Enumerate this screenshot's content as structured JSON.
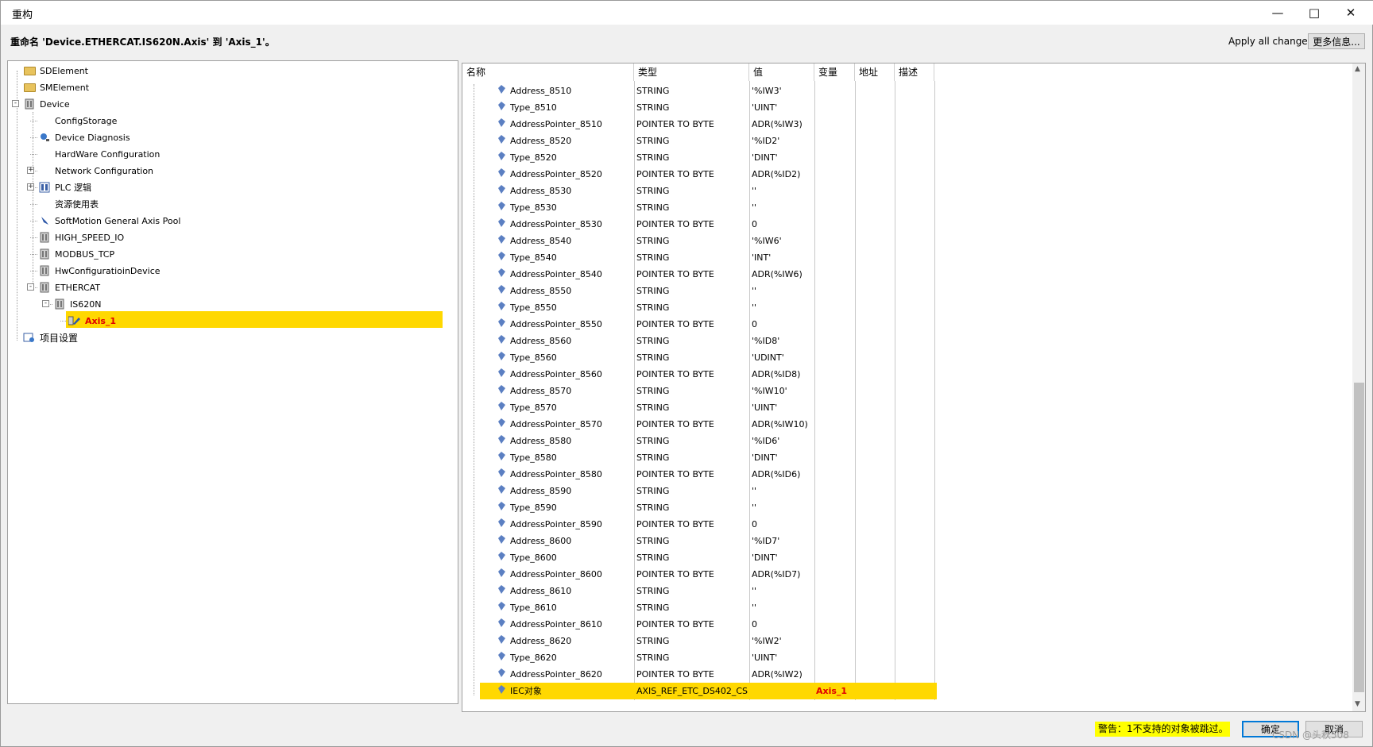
{
  "window": {
    "title": "重构",
    "minimize_icon": "minimize-icon",
    "maximize_icon": "maximize-icon",
    "close_icon": "close-icon"
  },
  "header": {
    "rename_text": "重命名 'Device.ETHERCAT.IS620N.Axis' 到 'Axis_1'。",
    "apply_label": "Apply all changes.",
    "more_button": "更多信息..."
  },
  "tree": {
    "items": [
      {
        "label": "SDElement",
        "icon": "folder-icon"
      },
      {
        "label": "SMElement",
        "icon": "folder-icon"
      },
      {
        "label": "Device",
        "icon": "device-icon"
      },
      {
        "label": "ConfigStorage",
        "icon": ""
      },
      {
        "label": "Device Diagnosis",
        "icon": "diagnosis-icon"
      },
      {
        "label": "HardWare Configuration",
        "icon": ""
      },
      {
        "label": "Network Configuration",
        "icon": ""
      },
      {
        "label": "PLC 逻辑",
        "icon": "plc-icon"
      },
      {
        "label": "资源使用表",
        "icon": ""
      },
      {
        "label": "SoftMotion General Axis Pool",
        "icon": "axis-pool-icon"
      },
      {
        "label": "HIGH_SPEED_IO",
        "icon": "module-icon"
      },
      {
        "label": "MODBUS_TCP",
        "icon": "module-icon"
      },
      {
        "label": "HwConfiguratioinDevice",
        "icon": "module-icon"
      },
      {
        "label": "ETHERCAT",
        "icon": "module-icon"
      },
      {
        "label": "IS620N",
        "icon": "module-icon"
      },
      {
        "label": "Axis_1",
        "icon": "axis-icon"
      },
      {
        "label": "项目设置",
        "icon": "project-settings-icon"
      }
    ]
  },
  "grid": {
    "columns": [
      "名称",
      "类型",
      "值",
      "变量",
      "地址",
      "描述"
    ],
    "rows": [
      {
        "name": "Address_8510",
        "type": "STRING",
        "value": "'%IW3'"
      },
      {
        "name": "Type_8510",
        "type": "STRING",
        "value": "'UINT'"
      },
      {
        "name": "AddressPointer_8510",
        "type": "POINTER TO BYTE",
        "value": "ADR(%IW3)"
      },
      {
        "name": "Address_8520",
        "type": "STRING",
        "value": "'%ID2'"
      },
      {
        "name": "Type_8520",
        "type": "STRING",
        "value": "'DINT'"
      },
      {
        "name": "AddressPointer_8520",
        "type": "POINTER TO BYTE",
        "value": "ADR(%ID2)"
      },
      {
        "name": "Address_8530",
        "type": "STRING",
        "value": "''"
      },
      {
        "name": "Type_8530",
        "type": "STRING",
        "value": "''"
      },
      {
        "name": "AddressPointer_8530",
        "type": "POINTER TO BYTE",
        "value": "0"
      },
      {
        "name": "Address_8540",
        "type": "STRING",
        "value": "'%IW6'"
      },
      {
        "name": "Type_8540",
        "type": "STRING",
        "value": "'INT'"
      },
      {
        "name": "AddressPointer_8540",
        "type": "POINTER TO BYTE",
        "value": "ADR(%IW6)"
      },
      {
        "name": "Address_8550",
        "type": "STRING",
        "value": "''"
      },
      {
        "name": "Type_8550",
        "type": "STRING",
        "value": "''"
      },
      {
        "name": "AddressPointer_8550",
        "type": "POINTER TO BYTE",
        "value": "0"
      },
      {
        "name": "Address_8560",
        "type": "STRING",
        "value": "'%ID8'"
      },
      {
        "name": "Type_8560",
        "type": "STRING",
        "value": "'UDINT'"
      },
      {
        "name": "AddressPointer_8560",
        "type": "POINTER TO BYTE",
        "value": "ADR(%ID8)"
      },
      {
        "name": "Address_8570",
        "type": "STRING",
        "value": "'%IW10'"
      },
      {
        "name": "Type_8570",
        "type": "STRING",
        "value": "'UINT'"
      },
      {
        "name": "AddressPointer_8570",
        "type": "POINTER TO BYTE",
        "value": "ADR(%IW10)"
      },
      {
        "name": "Address_8580",
        "type": "STRING",
        "value": "'%ID6'"
      },
      {
        "name": "Type_8580",
        "type": "STRING",
        "value": "'DINT'"
      },
      {
        "name": "AddressPointer_8580",
        "type": "POINTER TO BYTE",
        "value": "ADR(%ID6)"
      },
      {
        "name": "Address_8590",
        "type": "STRING",
        "value": "''"
      },
      {
        "name": "Type_8590",
        "type": "STRING",
        "value": "''"
      },
      {
        "name": "AddressPointer_8590",
        "type": "POINTER TO BYTE",
        "value": "0"
      },
      {
        "name": "Address_8600",
        "type": "STRING",
        "value": "'%ID7'"
      },
      {
        "name": "Type_8600",
        "type": "STRING",
        "value": "'DINT'"
      },
      {
        "name": "AddressPointer_8600",
        "type": "POINTER TO BYTE",
        "value": "ADR(%ID7)"
      },
      {
        "name": "Address_8610",
        "type": "STRING",
        "value": "''"
      },
      {
        "name": "Type_8610",
        "type": "STRING",
        "value": "''"
      },
      {
        "name": "AddressPointer_8610",
        "type": "POINTER TO BYTE",
        "value": "0"
      },
      {
        "name": "Address_8620",
        "type": "STRING",
        "value": "'%IW2'"
      },
      {
        "name": "Type_8620",
        "type": "STRING",
        "value": "'UINT'"
      },
      {
        "name": "AddressPointer_8620",
        "type": "POINTER TO BYTE",
        "value": "ADR(%IW2)"
      }
    ],
    "selected_row": {
      "name": "IEC对象",
      "type": "AXIS_REF_ETC_DS402_CS",
      "value": "",
      "variable": "Axis_1"
    }
  },
  "footer": {
    "warning": "警告：1不支持的对象被跳过。",
    "ok_button": "确定",
    "cancel_button": "取消",
    "watermark": "CSDN @头秋508"
  },
  "colors": {
    "selection": "#ffd800",
    "highlight_text": "#e00000",
    "warning_bg": "#ffff00",
    "accent": "#0078d7"
  }
}
